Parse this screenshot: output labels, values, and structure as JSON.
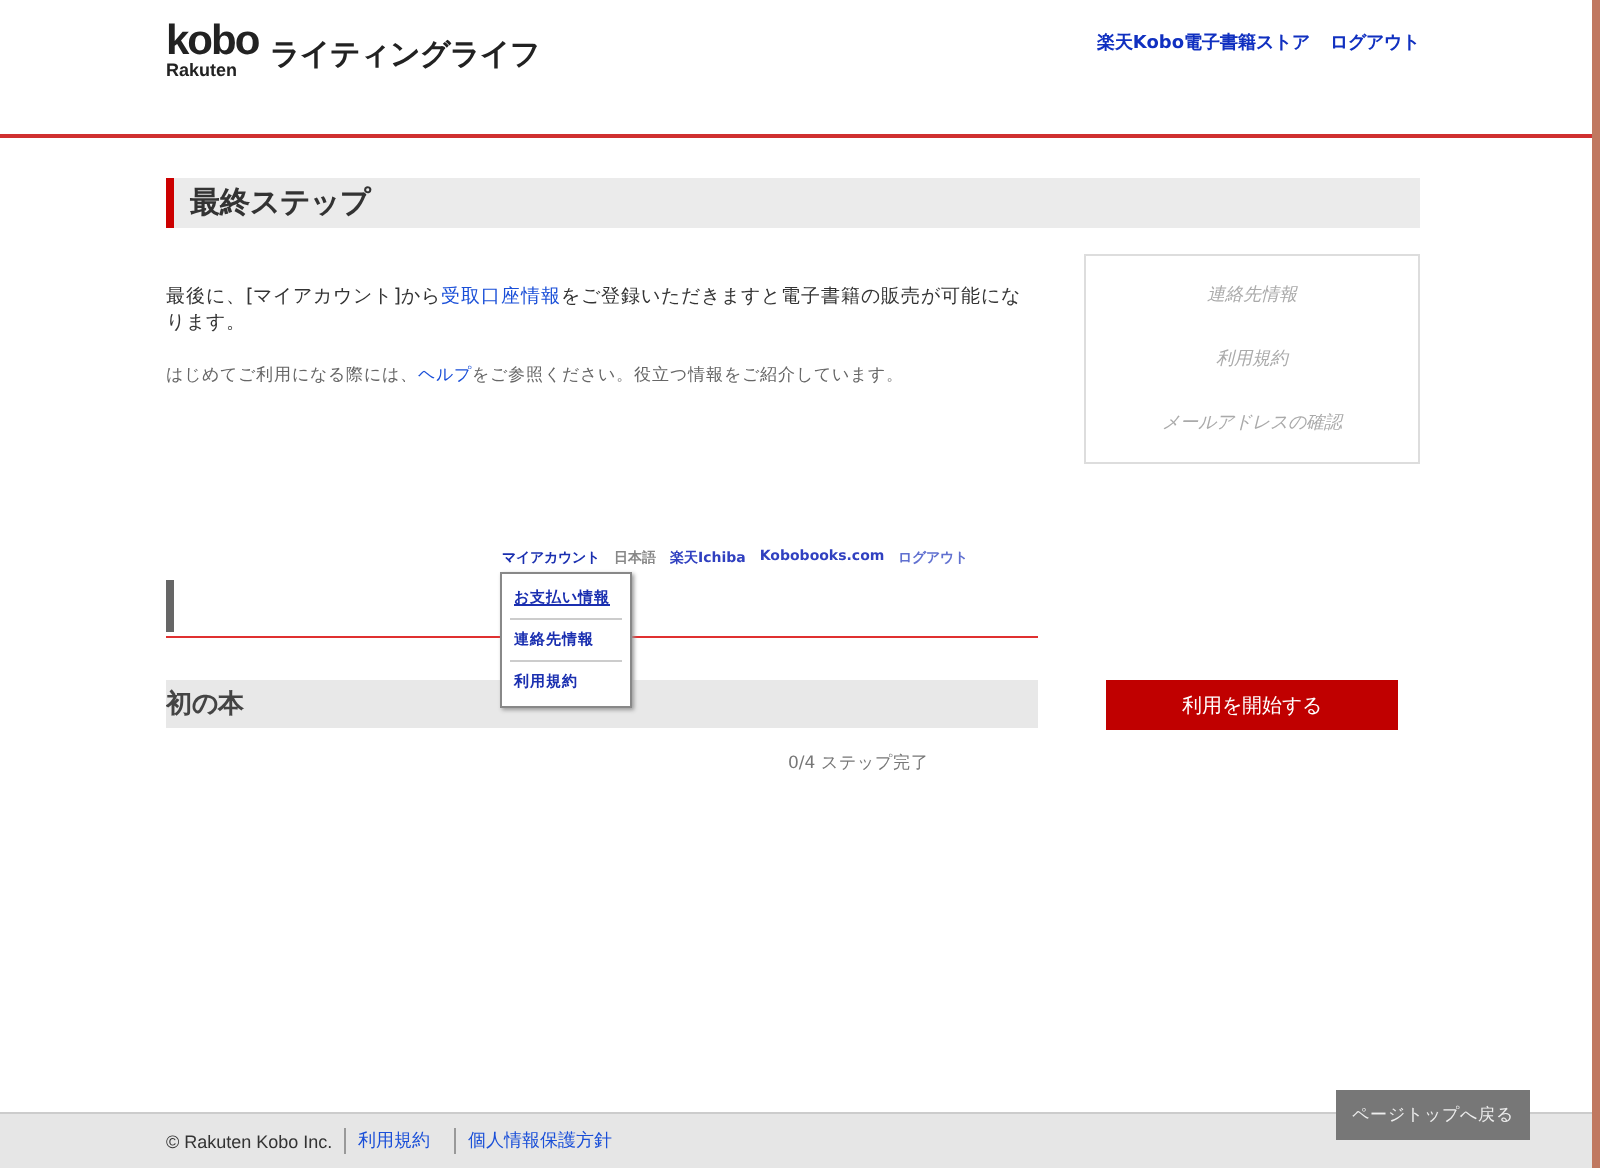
{
  "header": {
    "logo": {
      "brand": "kobo",
      "sub": "Rakuten"
    },
    "site_title": "ライティングライフ",
    "links": [
      "楽天Kobo電子書籍ストア",
      "ログアウト"
    ]
  },
  "section_title": "最終ステップ",
  "intro": {
    "before": "最後に、[マイアカウント]から",
    "link": "受取口座情報",
    "after": "をご登録いただきますと電子書籍の販売が可能になります。"
  },
  "help": {
    "before": "はじめてご利用になる際には、",
    "link": "ヘルプ",
    "after": "をご参照ください。役立つ情報をご紹介しています。"
  },
  "steps": [
    {
      "label": "連絡先情報",
      "done": false
    },
    {
      "label": "利用規約",
      "done": false
    },
    {
      "label": "メールアドレスの確認",
      "done": false
    }
  ],
  "example_screenshot": {
    "nav": [
      {
        "label": "マイアカウント",
        "kind": "menu"
      },
      {
        "label": "日本語",
        "kind": "dim"
      },
      {
        "label": "楽天Ichiba",
        "kind": "link"
      },
      {
        "label": "Kobobooks.com",
        "kind": "link"
      },
      {
        "label": "ログアウト",
        "kind": "faint"
      }
    ],
    "menu": [
      "お支払い情報",
      "連絡先情報",
      "利用規約"
    ],
    "heading": "初の本",
    "progress": "0/4 ステップ完了"
  },
  "start_button": "利用を開始する",
  "footer": {
    "copyright": "© Rakuten Kobo Inc.",
    "links": [
      "利用規約",
      "個人情報保護方針"
    ]
  },
  "page_top_button": "ページトップへ戻る"
}
